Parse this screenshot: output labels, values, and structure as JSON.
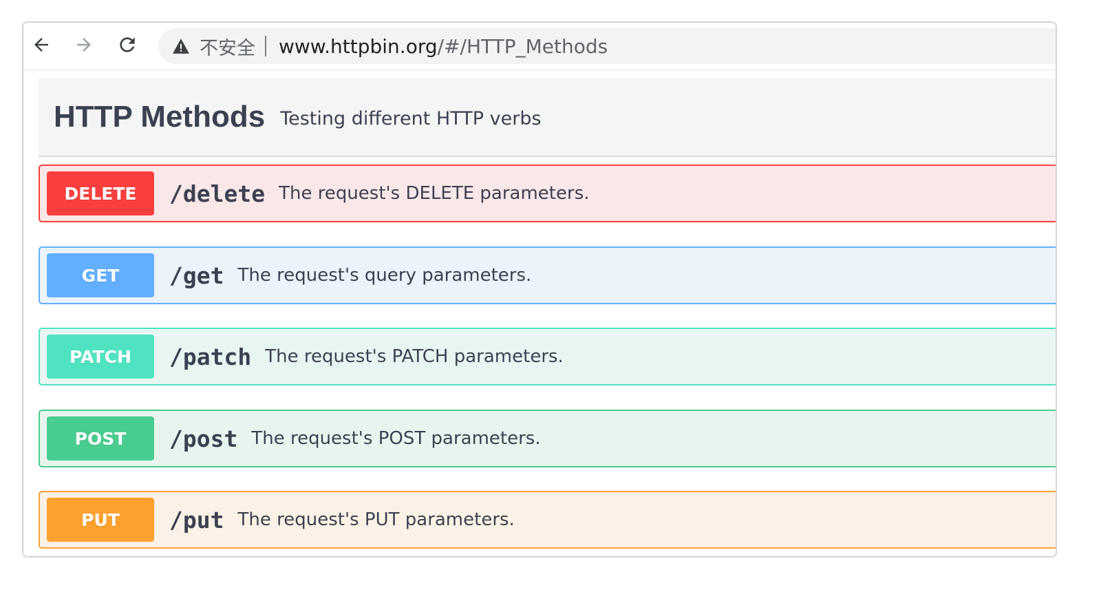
{
  "browser": {
    "back_icon": "arrow-left-icon",
    "forward_icon": "arrow-right-icon",
    "reload_icon": "reload-icon",
    "security_icon": "warning-triangle-icon",
    "security_label": "不安全",
    "url_host": "www.httpbin.org",
    "url_path": "/#/HTTP_Methods"
  },
  "tag": {
    "title": "HTTP Methods",
    "description": "Testing different HTTP verbs"
  },
  "operations": [
    {
      "method": "DELETE",
      "path": "/delete",
      "summary": "The request's DELETE parameters.",
      "badge_color": "#f93e3e",
      "border_color": "#f93e3e",
      "bg_color": "#fae7e7"
    },
    {
      "method": "GET",
      "path": "/get",
      "summary": "The request's query parameters.",
      "badge_color": "#61affe",
      "border_color": "#61affe",
      "bg_color": "#ebf3fb"
    },
    {
      "method": "PATCH",
      "path": "/patch",
      "summary": "The request's PATCH parameters.",
      "badge_color": "#50e3c2",
      "border_color": "#50e3c2",
      "bg_color": "#e8f6f2"
    },
    {
      "method": "POST",
      "path": "/post",
      "summary": "The request's POST parameters.",
      "badge_color": "#49cc90",
      "border_color": "#49cc90",
      "bg_color": "#e8f5ee"
    },
    {
      "method": "PUT",
      "path": "/put",
      "summary": "The request's PUT parameters.",
      "badge_color": "#fca130",
      "border_color": "#fca130",
      "bg_color": "#fbf1e6"
    }
  ]
}
